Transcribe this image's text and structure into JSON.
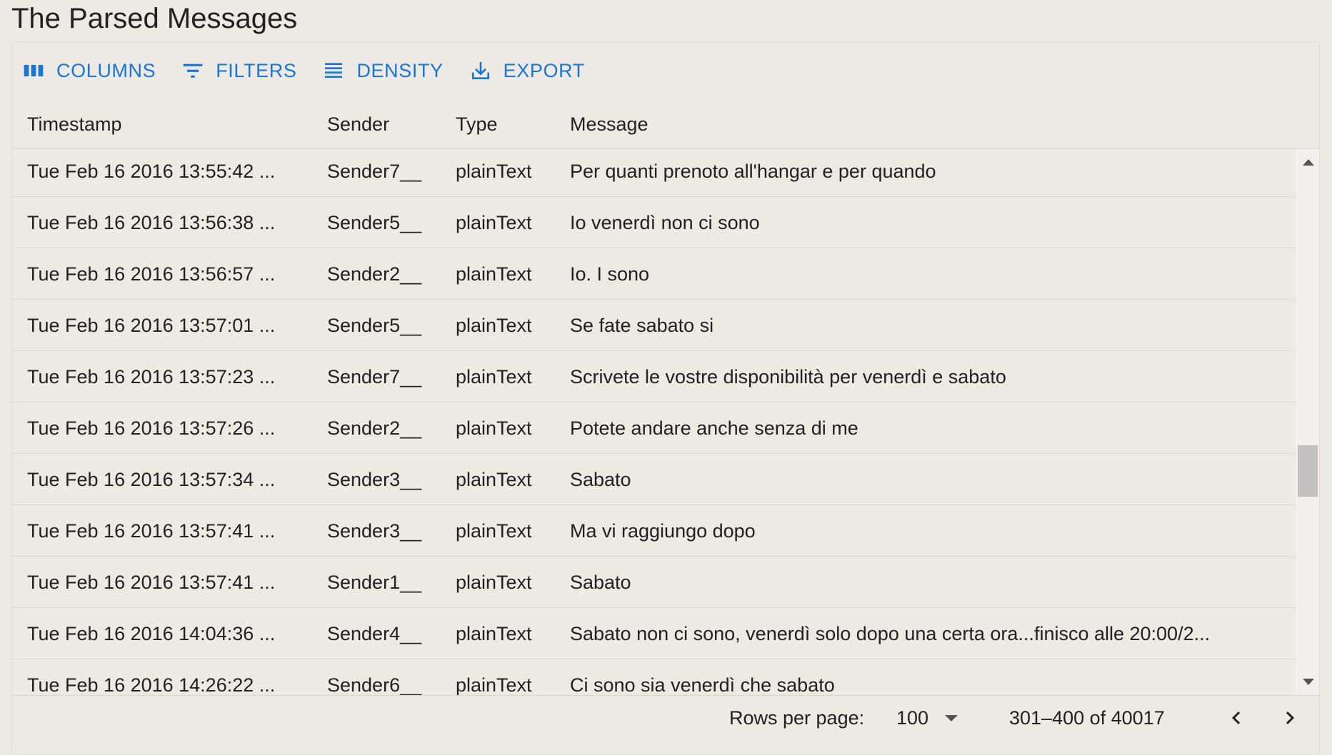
{
  "page": {
    "title": "The Parsed Messages"
  },
  "toolbar": {
    "columns_label": "COLUMNS",
    "filters_label": "FILTERS",
    "density_label": "DENSITY",
    "export_label": "EXPORT",
    "accent_color": "#1976d2"
  },
  "columns": {
    "timestamp": "Timestamp",
    "sender": "Sender",
    "type": "Type",
    "message": "Message"
  },
  "rows": [
    {
      "timestamp": "Tue Feb 16 2016 13:55:42 ...",
      "sender": "Sender7__",
      "type": "plainText",
      "message": "Per quanti prenoto all'hangar e per quando"
    },
    {
      "timestamp": "Tue Feb 16 2016 13:56:38 ...",
      "sender": "Sender5__",
      "type": "plainText",
      "message": "Io venerdì non ci sono"
    },
    {
      "timestamp": "Tue Feb 16 2016 13:56:57 ...",
      "sender": "Sender2__",
      "type": "plainText",
      "message": "Io. I sono"
    },
    {
      "timestamp": "Tue Feb 16 2016 13:57:01 ...",
      "sender": "Sender5__",
      "type": "plainText",
      "message": "Se fate sabato si"
    },
    {
      "timestamp": "Tue Feb 16 2016 13:57:23 ...",
      "sender": "Sender7__",
      "type": "plainText",
      "message": "Scrivete le vostre disponibilità per venerdì e sabato"
    },
    {
      "timestamp": "Tue Feb 16 2016 13:57:26 ...",
      "sender": "Sender2__",
      "type": "plainText",
      "message": "Potete andare anche senza di me"
    },
    {
      "timestamp": "Tue Feb 16 2016 13:57:34 ...",
      "sender": "Sender3__",
      "type": "plainText",
      "message": "Sabato"
    },
    {
      "timestamp": "Tue Feb 16 2016 13:57:41 ...",
      "sender": "Sender3__",
      "type": "plainText",
      "message": "Ma vi raggiungo dopo"
    },
    {
      "timestamp": "Tue Feb 16 2016 13:57:41 ...",
      "sender": "Sender1__",
      "type": "plainText",
      "message": "Sabato"
    },
    {
      "timestamp": "Tue Feb 16 2016 14:04:36 ...",
      "sender": "Sender4__",
      "type": "plainText",
      "message": "Sabato non ci sono, venerdì solo dopo una certa ora...finisco alle 20:00/2..."
    },
    {
      "timestamp": "Tue Feb 16 2016 14:26:22 ...",
      "sender": "Sender6__",
      "type": "plainText",
      "message": "Ci sono sia venerdì che sabato"
    }
  ],
  "pagination": {
    "rows_per_page_label": "Rows per page:",
    "rows_per_page_value": "100",
    "range_text": "301–400 of 40017"
  }
}
